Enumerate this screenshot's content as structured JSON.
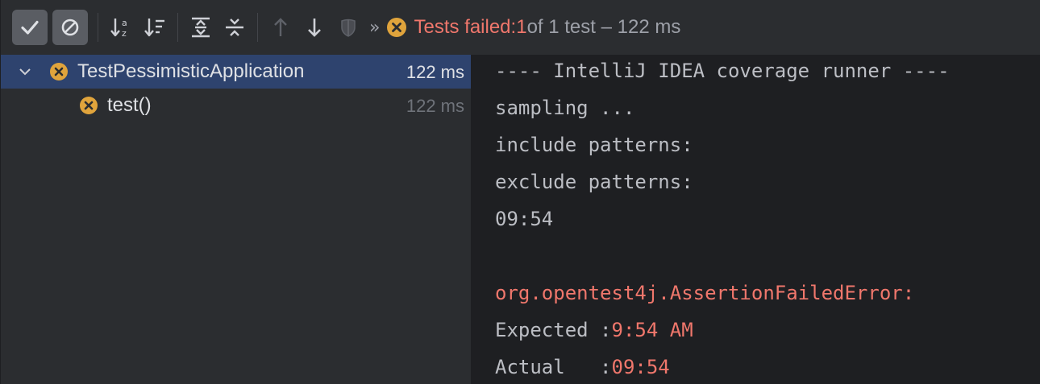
{
  "toolbar": {
    "buttons": [
      {
        "name": "show-passed",
        "icon": "checkmark-icon"
      },
      {
        "name": "show-ignored",
        "icon": "ignored-icon"
      },
      {
        "name": "sort-alphabetically",
        "icon": "sort-alpha-icon"
      },
      {
        "name": "sort-by-duration",
        "icon": "sort-duration-icon"
      },
      {
        "name": "expand-all",
        "icon": "expand-all-icon"
      },
      {
        "name": "collapse-all",
        "icon": "collapse-all-icon"
      },
      {
        "name": "previous-failed",
        "icon": "arrow-up-icon"
      },
      {
        "name": "next-failed",
        "icon": "arrow-down-icon"
      },
      {
        "name": "coverage",
        "icon": "shield-icon"
      },
      {
        "name": "more",
        "icon": "double-chevron-icon"
      }
    ],
    "more_glyph": "»",
    "status": {
      "prefix": "Tests failed: ",
      "failed_count": "1",
      "suffix": " of 1 test – 122 ms"
    }
  },
  "tree": {
    "items": [
      {
        "label": "TestPessimisticApplication",
        "time": "122 ms",
        "status": "failed",
        "selected": true
      },
      {
        "label": "test()",
        "time": "122 ms",
        "status": "failed",
        "selected": false
      }
    ]
  },
  "console": {
    "lines": [
      "---- IntelliJ IDEA coverage runner ----",
      "sampling ...",
      "include patterns:",
      "exclude patterns:",
      "09:54",
      "",
      "org.opentest4j.AssertionFailedError:"
    ],
    "expected_label": "Expected :",
    "expected_value": "9:54 AM",
    "actual_label": "Actual   :",
    "actual_value": "09:54"
  },
  "colors": {
    "accent_fail": "#f0776c",
    "fail_icon": "#e0a43c",
    "selection": "#2e436e"
  }
}
